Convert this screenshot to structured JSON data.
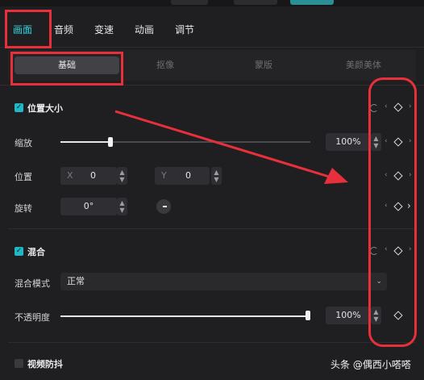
{
  "main_tabs": [
    "画面",
    "音频",
    "变速",
    "动画",
    "调节"
  ],
  "sub_tabs": [
    "基础",
    "抠像",
    "蒙版",
    "美颜美体"
  ],
  "position_size": {
    "title": "位置大小",
    "scale_label": "缩放",
    "scale_value": "100%",
    "scale_level": 0.2,
    "position_label": "位置",
    "x_axis": "X",
    "x_value": "0",
    "y_axis": "Y",
    "y_value": "0",
    "rotate_label": "旋转",
    "rotate_value": "0°"
  },
  "blend": {
    "title": "混合",
    "mode_label": "混合模式",
    "mode_value": "正常",
    "opacity_label": "不透明度",
    "opacity_value": "100%",
    "opacity_level": 1.0
  },
  "stabilize": {
    "title": "视频防抖"
  },
  "watermark": "头条 @偶西小嗒嗒",
  "annotation_color": "#e8303c",
  "accent_color": "#2fd5e0"
}
